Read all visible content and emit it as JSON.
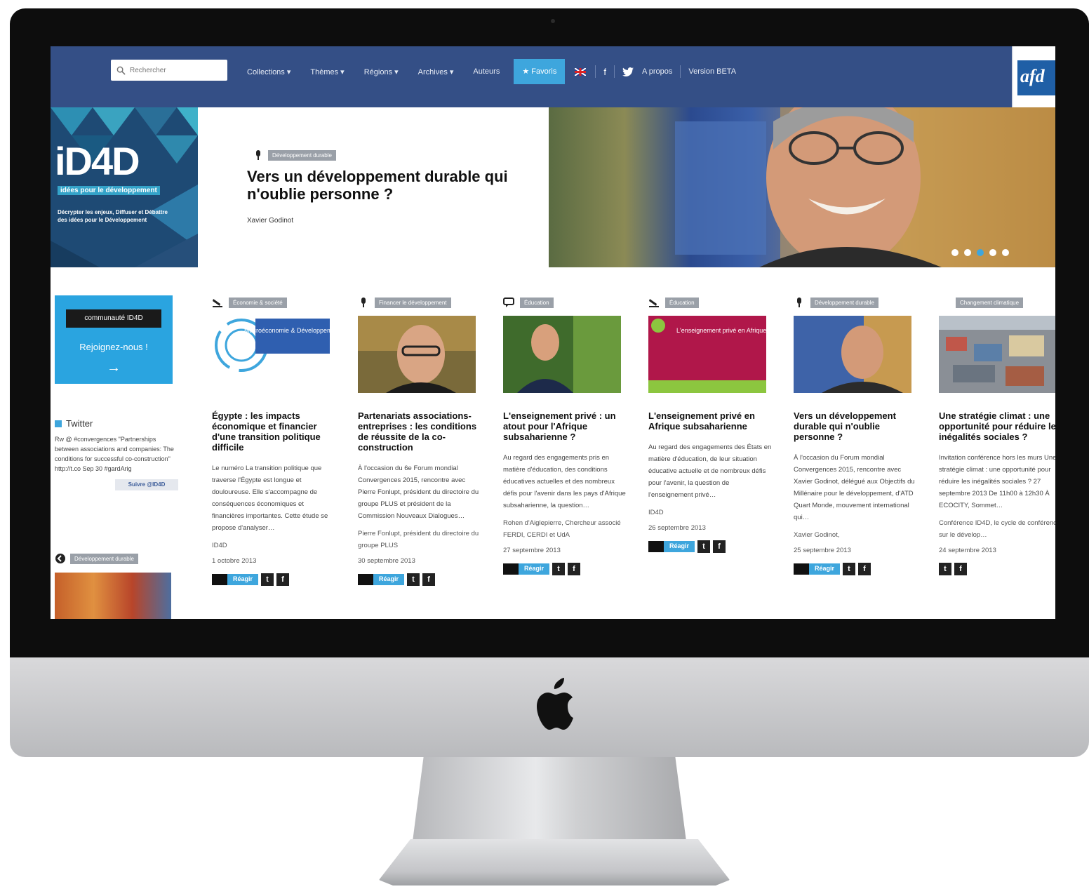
{
  "nav": {
    "search_placeholder": "Rechercher",
    "items": [
      "Collections ▾",
      "Thèmes ▾",
      "Régions ▾",
      "Archives ▾",
      "Auteurs"
    ],
    "favorites": "★ Favoris",
    "about": "A propos",
    "version": "Version BETA",
    "accent_color": "#3ea6dd",
    "bar_color": "#344f86"
  },
  "logo": {
    "text": "afd"
  },
  "hero": {
    "brand": "iD4D",
    "brand_sub": "idées pour le développement",
    "brand_desc": "Décrypter les enjeux, Diffuser et Débattre des idées pour le Développement",
    "tag": "Développement durable",
    "title": "Vers un développement durable qui n'oublie personne ?",
    "author": "Xavier Godinot"
  },
  "sidebar": {
    "community_pill": "communauté ID4D",
    "community_join": "Rejoignez-nous !",
    "twitter_title": "Twitter",
    "tweet": "Rw @ #convergences \"Partnerships between associations and companies: The conditions for successful co-construction\" http://t.co Sep 30 #gardArig",
    "follow": "Suivre @ID4D",
    "tag": "Développement durable"
  },
  "articles": [
    {
      "category": "Économie & société",
      "title": "Égypte : les impacts économique et financier d'une transition politique difficile",
      "desc": "Le numéro La transition politique que traverse l'Égypte est longue et douloureuse. Elle s'accompagne de conséquences économiques et financières importantes. Cette étude se propose d'analyser…",
      "meta": "ID4D",
      "date": "1 octobre 2013",
      "img_label": "Macroéconomie & Développement"
    },
    {
      "category": "Financer le développement",
      "title": "Partenariats associations-entreprises : les conditions de réussite de la co-construction",
      "desc": "À l'occasion du 6e Forum mondial Convergences 2015, rencontre avec Pierre Fonlupt, président du directoire du groupe PLUS et président de la Commission Nouveaux Dialogues…",
      "meta": "Pierre Fonlupt, président du directoire du groupe PLUS",
      "date": "30 septembre 2013"
    },
    {
      "category": "Éducation",
      "title": "L'enseignement privé : un atout pour l'Afrique subsaharienne ?",
      "desc": "Au regard des engagements pris en matière d'éducation, des conditions éducatives actuelles et des nombreux défis pour l'avenir dans les pays d'Afrique subsaharienne, la question…",
      "meta": "Rohen d'Aiglepierre, Chercheur associé FERDI, CERDI et UdA",
      "date": "27 septembre 2013"
    },
    {
      "category": "Éducation",
      "title": "L'enseignement privé en Afrique subsaharienne",
      "desc": "Au regard des engagements des États en matière d'éducation, de leur situation éducative actuelle et de nombreux défis pour l'avenir, la question de l'enseignement privé…",
      "meta": "ID4D",
      "date": "26 septembre 2013",
      "img_label": "L'enseignement privé en Afrique subsaharienne"
    },
    {
      "category": "Développement durable",
      "title": "Vers un développement durable qui n'oublie personne ?",
      "desc": "À l'occasion du Forum mondial Convergences 2015, rencontre avec Xavier Godinot, délégué aux Objectifs du Millénaire pour le développement, d'ATD Quart Monde, mouvement international qui…",
      "meta": "Xavier Godinot,",
      "date": "25 septembre 2013"
    },
    {
      "category": "Changement climatique",
      "title": "Une stratégie climat : une opportunité pour réduire les inégalités sociales ?",
      "desc": "Invitation conférence hors les murs Une stratégie climat : une opportunité pour réduire les inégalités sociales ? 27 septembre 2013 De 11h00 à 12h30 À ECOCITY, Sommet…",
      "meta": "Conférence ID4D, le cycle de conférences sur le dévelop…",
      "date": "24 septembre 2013"
    }
  ],
  "share": {
    "reagir": "Réagir",
    "twitter": "t",
    "facebook": "f"
  }
}
